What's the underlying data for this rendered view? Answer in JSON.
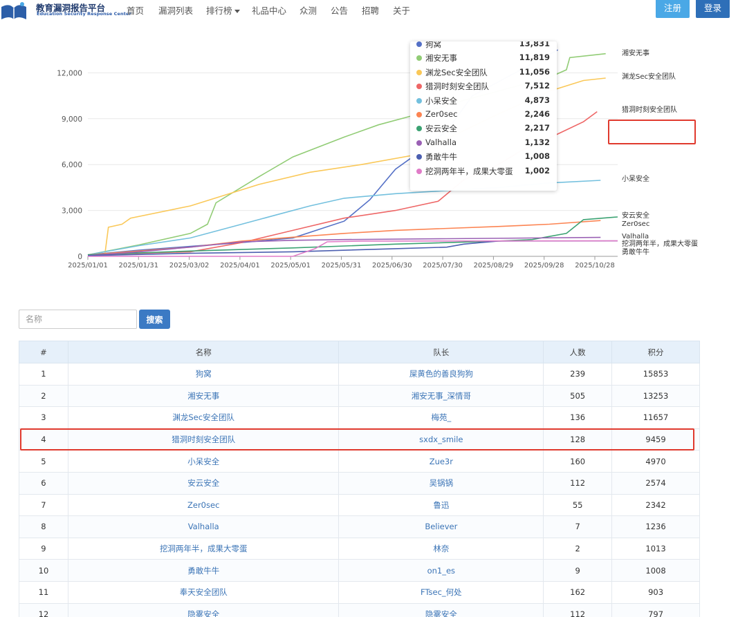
{
  "header": {
    "brand_title": "教育漏洞报告平台",
    "brand_subtitle": "Education Security Response Center",
    "nav": [
      "首页",
      "漏洞列表",
      "排行榜",
      "礼品中心",
      "众测",
      "公告",
      "招聘",
      "关于"
    ],
    "register_label": "注册",
    "login_label": "登录"
  },
  "chart_data": {
    "type": "line",
    "x_ticks": [
      "2025/01/01",
      "2025/01/31",
      "2025/03/02",
      "2025/04/01",
      "2025/05/01",
      "2025/05/31",
      "2025/06/30",
      "2025/07/30",
      "2025/08/29",
      "2025/09/28",
      "2025/10/28"
    ],
    "y_ticks": [
      "0",
      "3,000",
      "6,000",
      "9,000",
      "12,000"
    ],
    "ylim": [
      0,
      13500
    ],
    "grid": true,
    "series": [
      {
        "name": "狗窝",
        "color": "#5470c6",
        "points": [
          [
            0,
            100
          ],
          [
            30,
            400
          ],
          [
            60,
            650
          ],
          [
            90,
            900
          ],
          [
            120,
            1200
          ],
          [
            150,
            2300
          ],
          [
            165,
            3700
          ],
          [
            180,
            5700
          ],
          [
            195,
            6900
          ],
          [
            210,
            8200
          ],
          [
            225,
            10500
          ],
          [
            240,
            11400
          ],
          [
            260,
            12600
          ],
          [
            275,
            13500
          ]
        ]
      },
      {
        "name": "湘安无事",
        "color": "#91cc75",
        "points": [
          [
            0,
            100
          ],
          [
            30,
            750
          ],
          [
            60,
            1500
          ],
          [
            70,
            2100
          ],
          [
            75,
            3500
          ],
          [
            100,
            5200
          ],
          [
            120,
            6500
          ],
          [
            150,
            7800
          ],
          [
            170,
            8600
          ],
          [
            190,
            9200
          ],
          [
            220,
            10200
          ],
          [
            250,
            11100
          ],
          [
            270,
            11700
          ],
          [
            280,
            12200
          ],
          [
            282,
            13000
          ],
          [
            303,
            13253
          ]
        ]
      },
      {
        "name": "渊龙Sec安全团队",
        "color": "#fac858",
        "points": [
          [
            0,
            100
          ],
          [
            10,
            150
          ],
          [
            12,
            1900
          ],
          [
            20,
            2100
          ],
          [
            25,
            2500
          ],
          [
            60,
            3300
          ],
          [
            100,
            4700
          ],
          [
            130,
            5500
          ],
          [
            160,
            6000
          ],
          [
            190,
            6600
          ],
          [
            240,
            9300
          ],
          [
            270,
            10800
          ],
          [
            290,
            11500
          ],
          [
            303,
            11657
          ]
        ]
      },
      {
        "name": "猎洞时刻安全团队",
        "color": "#ee6666",
        "points": [
          [
            0,
            100
          ],
          [
            60,
            300
          ],
          [
            90,
            900
          ],
          [
            120,
            1700
          ],
          [
            150,
            2500
          ],
          [
            180,
            3000
          ],
          [
            205,
            3600
          ],
          [
            220,
            5000
          ],
          [
            240,
            6000
          ],
          [
            255,
            7000
          ],
          [
            275,
            8000
          ],
          [
            290,
            8800
          ],
          [
            298,
            9459
          ]
        ]
      },
      {
        "name": "小呆安全",
        "color": "#73c0de",
        "points": [
          [
            0,
            100
          ],
          [
            30,
            700
          ],
          [
            60,
            1200
          ],
          [
            90,
            2100
          ],
          [
            110,
            2700
          ],
          [
            130,
            3300
          ],
          [
            150,
            3800
          ],
          [
            180,
            4100
          ],
          [
            240,
            4500
          ],
          [
            270,
            4800
          ],
          [
            300,
            4970
          ]
        ]
      },
      {
        "name": "Zer0sec",
        "color": "#fc8452",
        "points": [
          [
            0,
            100
          ],
          [
            60,
            600
          ],
          [
            90,
            1000
          ],
          [
            120,
            1250
          ],
          [
            150,
            1500
          ],
          [
            180,
            1700
          ],
          [
            240,
            1950
          ],
          [
            270,
            2100
          ],
          [
            300,
            2342
          ]
        ]
      },
      {
        "name": "安云安全",
        "color": "#3ba272",
        "points": [
          [
            0,
            100
          ],
          [
            60,
            350
          ],
          [
            120,
            550
          ],
          [
            180,
            800
          ],
          [
            240,
            1000
          ],
          [
            260,
            1100
          ],
          [
            280,
            1500
          ],
          [
            290,
            2400
          ],
          [
            310,
            2574
          ]
        ]
      },
      {
        "name": "Valhalla",
        "color": "#9a60b4",
        "points": [
          [
            0,
            50
          ],
          [
            30,
            300
          ],
          [
            60,
            600
          ],
          [
            90,
            950
          ],
          [
            120,
            1050
          ],
          [
            150,
            1100
          ],
          [
            210,
            1150
          ],
          [
            300,
            1236
          ]
        ]
      },
      {
        "name": "勇敢牛牛",
        "color": "#4c5fb0",
        "points": [
          [
            0,
            50
          ],
          [
            60,
            200
          ],
          [
            120,
            300
          ],
          [
            180,
            500
          ],
          [
            210,
            600
          ],
          [
            220,
            800
          ],
          [
            230,
            900
          ],
          [
            240,
            1000
          ],
          [
            310,
            1008
          ]
        ]
      },
      {
        "name": "挖洞两年半，成果大零蛋",
        "color": "#e07cc8",
        "points": [
          [
            0,
            0
          ],
          [
            120,
            0
          ],
          [
            133,
            500
          ],
          [
            140,
            950
          ],
          [
            160,
            1000
          ],
          [
            310,
            1013
          ]
        ]
      }
    ],
    "end_labels": [
      {
        "name": "湘安无事",
        "value": 13253
      },
      {
        "name": "渊龙Sec安全团队",
        "value": 11657
      },
      {
        "name": "猎洞时刻安全团队",
        "value": 9459
      },
      {
        "name": "小呆安全",
        "value": 4970
      },
      {
        "name": "安云安全",
        "value": 2574
      },
      {
        "name": "Zer0sec",
        "value": 2342
      },
      {
        "name": "Valhalla",
        "value": 1236
      },
      {
        "name": "挖洞两年半，成果大零蛋",
        "value": 1013
      },
      {
        "name": "勇敢牛牛",
        "value": 1008
      }
    ]
  },
  "tooltip": {
    "items": [
      {
        "name": "狗窝",
        "value": "13,831",
        "color": "#5470c6"
      },
      {
        "name": "湘安无事",
        "value": "11,819",
        "color": "#91cc75"
      },
      {
        "name": "渊龙Sec安全团队",
        "value": "11,056",
        "color": "#fac858"
      },
      {
        "name": "猎洞时刻安全团队",
        "value": "7,512",
        "color": "#ee6666"
      },
      {
        "name": "小呆安全",
        "value": "4,873",
        "color": "#73c0de"
      },
      {
        "name": "Zer0sec",
        "value": "2,246",
        "color": "#fc8452"
      },
      {
        "name": "安云安全",
        "value": "2,217",
        "color": "#3ba272"
      },
      {
        "name": "Valhalla",
        "value": "1,132",
        "color": "#9a60b4"
      },
      {
        "name": "勇敢牛牛",
        "value": "1,008",
        "color": "#4c5fb0"
      },
      {
        "name": "挖洞两年半，成果大零蛋",
        "value": "1,002",
        "color": "#e07cc8"
      }
    ]
  },
  "search": {
    "placeholder": "名称",
    "button_label": "搜索"
  },
  "table": {
    "headers": [
      "#",
      "名称",
      "队长",
      "人数",
      "积分"
    ],
    "rows": [
      [
        "1",
        "狗窝",
        "屎黄色的善良狗狗",
        "239",
        "15853"
      ],
      [
        "2",
        "湘安无事",
        "湘安无事_深情哥",
        "505",
        "13253"
      ],
      [
        "3",
        "渊龙Sec安全团队",
        "梅苑_",
        "136",
        "11657"
      ],
      [
        "4",
        "猎洞时刻安全团队",
        "sxdx_smile",
        "128",
        "9459"
      ],
      [
        "5",
        "小呆安全",
        "Zue3r",
        "160",
        "4970"
      ],
      [
        "6",
        "安云安全",
        "吴锅锅",
        "112",
        "2574"
      ],
      [
        "7",
        "Zer0sec",
        "鲁迅",
        "55",
        "2342"
      ],
      [
        "8",
        "Valhalla",
        "Believer",
        "7",
        "1236"
      ],
      [
        "9",
        "挖洞两年半，成果大零蛋",
        "林奈",
        "2",
        "1013"
      ],
      [
        "10",
        "勇敢牛牛",
        "on1_es",
        "9",
        "1008"
      ],
      [
        "11",
        "奉天安全团队",
        "FTsec_何处",
        "162",
        "903"
      ],
      [
        "12",
        "隐雾安全",
        "隐雾安全",
        "112",
        "797"
      ]
    ]
  }
}
